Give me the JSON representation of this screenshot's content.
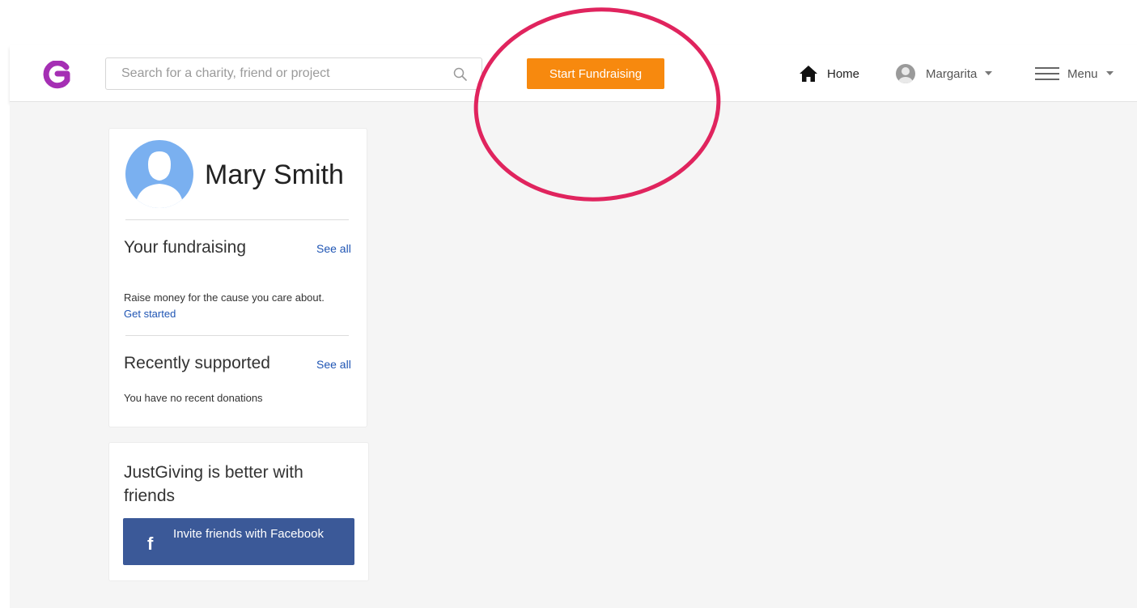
{
  "nav": {
    "search_placeholder": "Search for a charity, friend or project",
    "start_button": "Start Fundraising",
    "home_label": "Home",
    "user_label": "Margarita",
    "menu_label": "Menu"
  },
  "profile": {
    "name": "Mary Smith",
    "fundraising_title": "Your fundraising",
    "fundraising_see_all": "See all",
    "fundraising_text": "Raise money for the cause you care about.",
    "get_started": "Get started",
    "recent_title": "Recently supported",
    "recent_see_all": "See all",
    "recent_text": "You have no recent donations"
  },
  "friends": {
    "title": "JustGiving is better with friends",
    "fb_icon": "f",
    "fb_button": "Invite friends with Facebook"
  },
  "colors": {
    "brand_purple": "#a52fb4",
    "accent_orange": "#f7890e",
    "link_blue": "#1f55b4",
    "facebook_blue": "#3b5998",
    "annotation_red": "#e0245e"
  },
  "icons": {
    "logo": "justgiving-logo-icon",
    "search": "search-icon",
    "home": "home-icon",
    "user": "user-avatar-icon",
    "menu": "hamburger-icon",
    "caret": "chevron-down-icon",
    "facebook": "facebook-icon"
  }
}
